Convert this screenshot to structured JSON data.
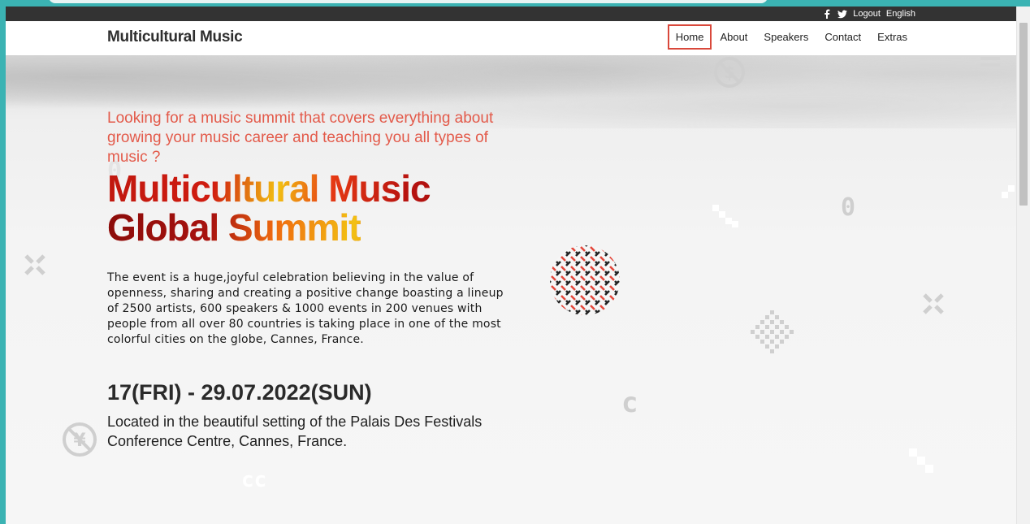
{
  "topbar": {
    "logout": "Logout",
    "language": "English",
    "icons": [
      "facebook-icon",
      "twitter-icon"
    ]
  },
  "header": {
    "brand": "Multicultural Music",
    "nav": [
      {
        "label": "Home",
        "active": true
      },
      {
        "label": "About",
        "active": false
      },
      {
        "label": "Speakers",
        "active": false
      },
      {
        "label": "Contact",
        "active": false
      },
      {
        "label": "Extras",
        "active": false
      }
    ]
  },
  "hero": {
    "tagline": "Looking for a music summit that covers everything about growing your music career and teaching you all types of music ?",
    "title_line1": "Multicultural Music",
    "title_line2": "Global Summit",
    "description": "The event is a huge,joyful celebration believing in the value of openness, sharing and creating a positive change boasting a lineup of 2500 artists, 600 speakers & 1000 events in 200 venues with people from all over 80 countries is taking place in one of the most colorful cities on the globe, Cannes, France.",
    "date": "17(FRI) - 29.07.2022(SUN)",
    "venue": "Located in the beautiful setting of the Palais Des Festivals Conference Centre, Cannes, France."
  },
  "colors": {
    "accent": "#e35a4a",
    "active_nav_border": "#d9483b",
    "topbar_bg": "#333333",
    "window_frame": "#3bb3b3"
  }
}
